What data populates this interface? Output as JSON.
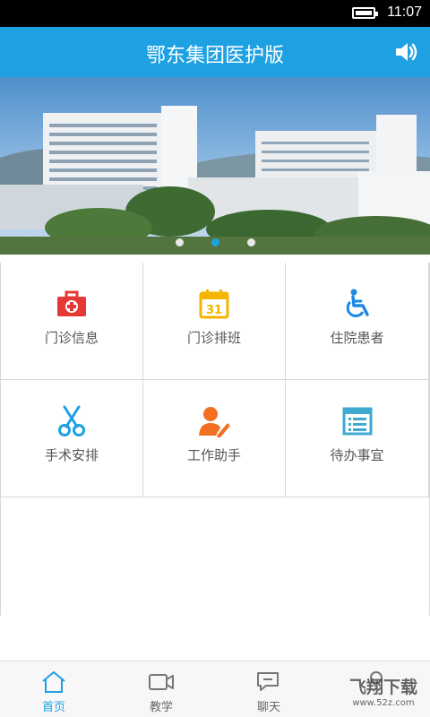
{
  "status_bar": {
    "time": "11:07"
  },
  "header": {
    "title": "鄂东集团医护版"
  },
  "banner": {
    "slides": 3,
    "active_index": 1
  },
  "menu": [
    {
      "label": "门诊信息",
      "icon": "first-aid-kit-icon",
      "color": "#e53935"
    },
    {
      "label": "门诊排班",
      "icon": "calendar-icon",
      "color": "#f4b400"
    },
    {
      "label": "住院患者",
      "icon": "wheelchair-icon",
      "color": "#1e88e5"
    },
    {
      "label": "手术安排",
      "icon": "scissors-icon",
      "color": "#1da1e2"
    },
    {
      "label": "工作助手",
      "icon": "user-edit-icon",
      "color": "#f36f21"
    },
    {
      "label": "待办事宜",
      "icon": "list-icon",
      "color": "#3fa9d1"
    }
  ],
  "tabs": [
    {
      "label": "首页",
      "icon": "home-icon",
      "active": true
    },
    {
      "label": "教学",
      "icon": "video-camera-icon",
      "active": false
    },
    {
      "label": "聊天",
      "icon": "chat-icon",
      "active": false
    },
    {
      "label": "",
      "icon": "user-icon",
      "active": false
    }
  ],
  "watermark": {
    "text": "飞翔下载",
    "sub": "www.52z.com"
  },
  "accent_color": "#1da1e2"
}
